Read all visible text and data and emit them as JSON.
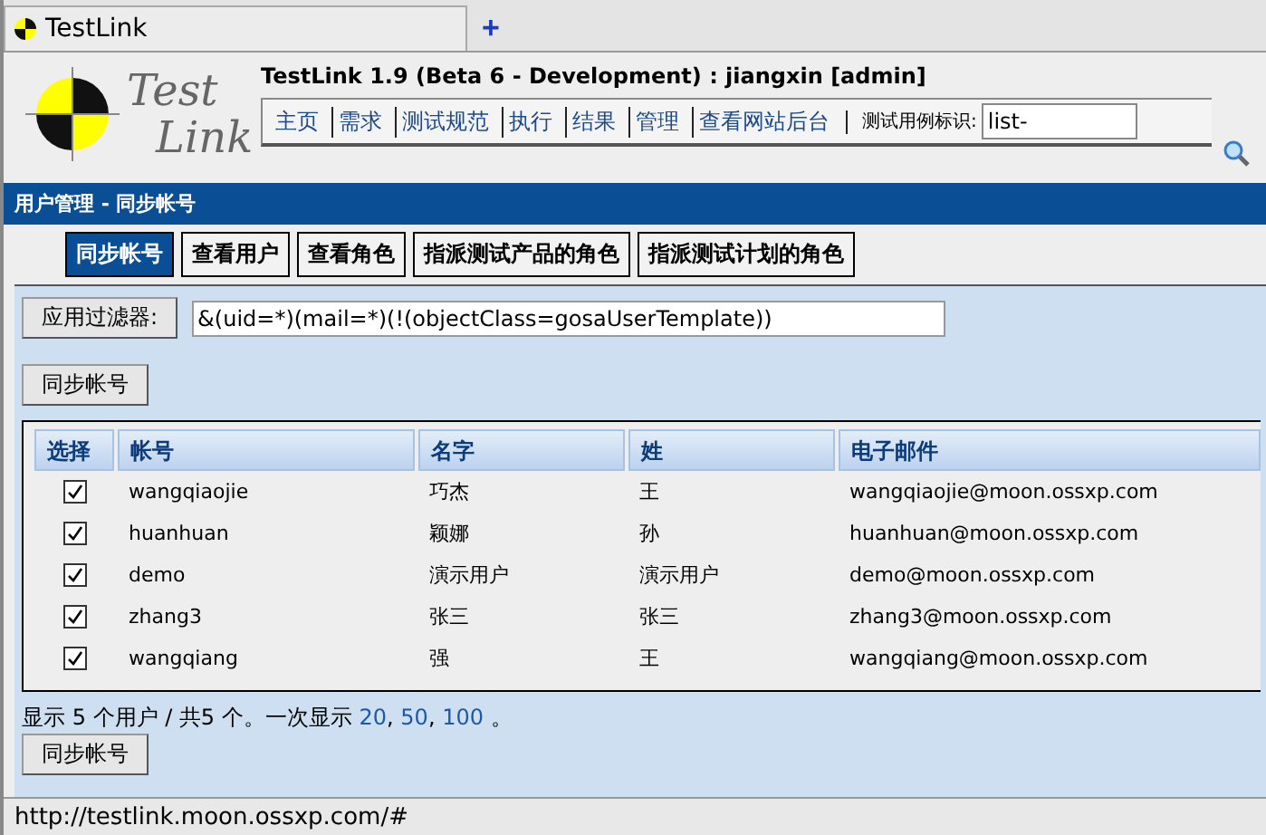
{
  "browser_tab": {
    "title": "TestLink",
    "new_tab": "+"
  },
  "logo": {
    "line_1": "Test",
    "line_2": "Link"
  },
  "header": {
    "title": "TestLink 1.9 (Beta 6 - Development) : jiangxin [admin]"
  },
  "menu": [
    {
      "label": "主页"
    },
    {
      "label": "需求"
    },
    {
      "label": "测试规范"
    },
    {
      "label": "执行"
    },
    {
      "label": "结果"
    },
    {
      "label": "管理"
    },
    {
      "label": "查看网站后台"
    }
  ],
  "search": {
    "label": "测试用例标识:",
    "value": "list-"
  },
  "section_title": "用户管理 - 同步帐号",
  "tabs": [
    {
      "label": "同步帐号",
      "selected": true
    },
    {
      "label": "查看用户",
      "selected": false
    },
    {
      "label": "查看角色",
      "selected": false
    },
    {
      "label": "指派测试产品的角色",
      "selected": false
    },
    {
      "label": "指派测试计划的角色",
      "selected": false
    }
  ],
  "filter": {
    "button": "应用过滤器:",
    "value": "&(uid=*)(mail=*)(!(objectClass=gosaUserTemplate))"
  },
  "sync_button_top": "同步帐号",
  "table": {
    "columns": [
      "选择",
      "帐号",
      "名字",
      "姓",
      "电子邮件"
    ],
    "rows": [
      {
        "checked": true,
        "account": "wangqiaojie",
        "first_name": "巧杰",
        "last_name": "王",
        "email": "wangqiaojie@moon.ossxp.com"
      },
      {
        "checked": true,
        "account": "huanhuan",
        "first_name": "颖娜",
        "last_name": "孙",
        "email": "huanhuan@moon.ossxp.com"
      },
      {
        "checked": true,
        "account": "demo",
        "first_name": "演示用户",
        "last_name": "演示用户",
        "email": "demo@moon.ossxp.com"
      },
      {
        "checked": true,
        "account": "zhang3",
        "first_name": "张三",
        "last_name": "张三",
        "email": "zhang3@moon.ossxp.com"
      },
      {
        "checked": true,
        "account": "wangqiang",
        "first_name": "强",
        "last_name": "王",
        "email": "wangqiang@moon.ossxp.com"
      }
    ]
  },
  "summary": {
    "text": "显示 5 个用户 / 共5 个。一次显示",
    "page_sizes": [
      "20",
      "50",
      "100"
    ],
    "separator": ",",
    "suffix": "。"
  },
  "sync_button_bottom": "同步帐号",
  "status_bar": "http://testlink.moon.ossxp.com/#"
}
